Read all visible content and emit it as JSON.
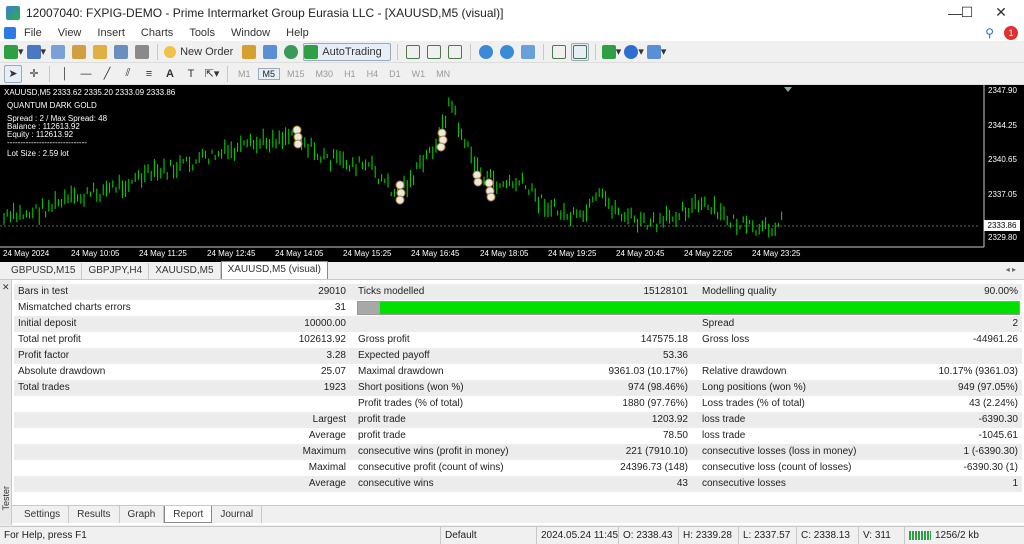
{
  "window": {
    "title": "12007040: FXPIG-DEMO - Prime Intermarket Group Eurasia LLC - [XAUUSD,M5 (visual)]",
    "minimize": "—",
    "maximize": "☐",
    "close": "✕"
  },
  "menu": {
    "items": [
      "File",
      "View",
      "Insert",
      "Charts",
      "Tools",
      "Window",
      "Help"
    ],
    "notification_count": "1"
  },
  "toolbar1": {
    "new_order": "New Order",
    "autotrading": "AutoTrading"
  },
  "toolbar2": {
    "timeframes": [
      "M1",
      "M5",
      "M15",
      "M30",
      "H1",
      "H4",
      "D1",
      "W1",
      "MN"
    ],
    "active_timeframe": "M5"
  },
  "chart": {
    "ohlc_header": "XAUUSD,M5  2333.62 2335.20 2333.09 2333.86",
    "ea_name": "QUANTUM DARK GOLD",
    "ea_spread": "Spread : 2 / Max Spread: 48",
    "ea_balance": "Balance : 112613.92",
    "ea_equity": "Equity : 112613.92",
    "ea_divider": "------------------------------",
    "ea_lot": "Lot Size : 2.59 lot",
    "price_axis": [
      "2347.90",
      "2344.25",
      "2340.65",
      "2337.05",
      "2333.40",
      "2329.80"
    ],
    "current_price": "2333.86",
    "time_axis": [
      "24 May 2024",
      "24 May 10:05",
      "24 May 11:25",
      "24 May 12:45",
      "24 May 14:05",
      "24 May 15:25",
      "24 May 16:45",
      "24 May 18:05",
      "24 May 19:25",
      "24 May 20:45",
      "24 May 22:05",
      "24 May 23:25"
    ],
    "colors": {
      "background": "#000000",
      "bull": "#00e000",
      "bear": "#00e000",
      "grid": "#ffffff"
    }
  },
  "chart_tabs": [
    "GBPUSD,M15",
    "GBPJPY,H4",
    "XAUUSD,M5",
    "XAUUSD,M5 (visual)"
  ],
  "report": {
    "r1": {
      "a": "Bars in test",
      "b": "29010",
      "c": "Ticks modelled",
      "d": "15128101",
      "e": "Modelling quality",
      "f": "90.00%"
    },
    "r2": {
      "a": "Mismatched charts errors",
      "b": "31"
    },
    "modelling_quality_fraction": 0.9,
    "r3": {
      "a": "Initial deposit",
      "b": "10000.00",
      "e": "Spread",
      "f": "2"
    },
    "r4": {
      "a": "Total net profit",
      "b": "102613.92",
      "c": "Gross profit",
      "d": "147575.18",
      "e": "Gross loss",
      "f": "-44961.26"
    },
    "r5": {
      "a": "Profit factor",
      "b": "3.28",
      "c": "Expected payoff",
      "d": "53.36"
    },
    "r6": {
      "a": "Absolute drawdown",
      "b": "25.07",
      "c": "Maximal drawdown",
      "d": "9361.03 (10.17%)",
      "e": "Relative drawdown",
      "f": "10.17% (9361.03)"
    },
    "r7": {
      "a": "Total trades",
      "b": "1923",
      "c": "Short positions (won %)",
      "d": "974 (98.46%)",
      "e": "Long positions (won %)",
      "f": "949 (97.05%)"
    },
    "r8": {
      "c": "Profit trades (% of total)",
      "d": "1880 (97.76%)",
      "e": "Loss trades (% of total)",
      "f": "43 (2.24%)"
    },
    "r9": {
      "b": "Largest",
      "c": "profit trade",
      "d": "1203.92",
      "e": "loss trade",
      "f": "-6390.30"
    },
    "r10": {
      "b": "Average",
      "c": "profit trade",
      "d": "78.50",
      "e": "loss trade",
      "f": "-1045.61"
    },
    "r11": {
      "b": "Maximum",
      "c": "consecutive wins (profit in money)",
      "d": "221 (7910.10)",
      "e": "consecutive losses (loss in money)",
      "f": "1 (-6390.30)"
    },
    "r12": {
      "b": "Maximal",
      "c": "consecutive profit (count of wins)",
      "d": "24396.73 (148)",
      "e": "consecutive loss (count of losses)",
      "f": "-6390.30 (1)"
    },
    "r13": {
      "b": "Average",
      "c": "consecutive wins",
      "d": "43",
      "e": "consecutive losses",
      "f": "1"
    }
  },
  "tester_label": "Tester",
  "bottom_tabs": [
    "Settings",
    "Results",
    "Graph",
    "Report",
    "Journal"
  ],
  "active_bottom_tab": "Report",
  "status": {
    "help": "For Help, press F1",
    "profile": "Default",
    "datetime": "2024.05.24 11:45",
    "open": "O: 2338.43",
    "high": "H: 2339.28",
    "low": "L: 2337.57",
    "close": "C: 2338.13",
    "volume": "V: 311",
    "traffic": "1256/2 kb"
  }
}
